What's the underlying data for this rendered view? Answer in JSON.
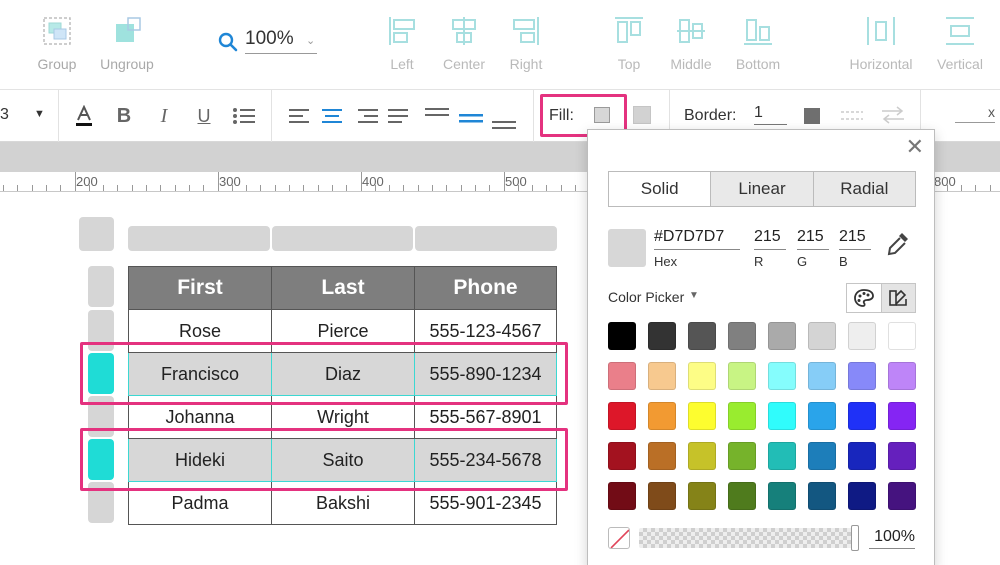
{
  "toolbar": {
    "group_label": "Group",
    "ungroup_label": "Ungroup",
    "zoom_value": "100%",
    "align": {
      "left": "Left",
      "center": "Center",
      "right": "Right",
      "top": "Top",
      "middle": "Middle",
      "bottom": "Bottom"
    },
    "distribute": {
      "horizontal": "Horizontal",
      "vertical": "Vertical"
    }
  },
  "format_bar": {
    "font_size_partial": "3",
    "fill_label": "Fill:",
    "fill_color": "#D7D7D7",
    "border_label": "Border:",
    "border_width": "1",
    "x_value": "x"
  },
  "ruler": {
    "labels": [
      "200",
      "300",
      "400",
      "500",
      "800"
    ]
  },
  "table": {
    "headers": [
      "First",
      "Last",
      "Phone"
    ],
    "rows": [
      {
        "first": "Rose",
        "last": "Pierce",
        "phone": "555-123-4567",
        "selected": false
      },
      {
        "first": "Francisco",
        "last": "Diaz",
        "phone": "555-890-1234",
        "selected": true
      },
      {
        "first": "Johanna",
        "last": "Wright",
        "phone": "555-567-8901",
        "selected": false
      },
      {
        "first": "Hideki",
        "last": "Saito",
        "phone": "555-234-5678",
        "selected": true
      },
      {
        "first": "Padma",
        "last": "Bakshi",
        "phone": "555-901-2345",
        "selected": false
      }
    ],
    "header_bg": "#7E7E7E",
    "selected_bg": "#D7D7D7",
    "selection_accent": "#1FDCD6",
    "highlight_color": "#E4327F"
  },
  "color_picker": {
    "tabs": [
      "Solid",
      "Linear",
      "Radial"
    ],
    "active_tab": "Solid",
    "hex_value": "#D7D7D7",
    "hex_label": "Hex",
    "r_value": "215",
    "g_value": "215",
    "b_value": "215",
    "r_label": "R",
    "g_label": "G",
    "b_label": "B",
    "picker_label": "Color Picker",
    "opacity": "100%",
    "swatches": [
      [
        "#000000",
        "#333333",
        "#555555",
        "#808080",
        "#aaaaaa",
        "#d4d4d4",
        "#eeeeee",
        "#ffffff"
      ],
      [
        "#ea7f8a",
        "#f7c98f",
        "#fdfd86",
        "#c8f484",
        "#85fdfd",
        "#86cdf7",
        "#8789f9",
        "#be85f8"
      ],
      [
        "#dd1729",
        "#f29a32",
        "#fdfd2f",
        "#99ec2f",
        "#30fcfc",
        "#2aa4ea",
        "#1f31f7",
        "#8525f3"
      ],
      [
        "#a3121f",
        "#ba6f26",
        "#c6c229",
        "#76b32b",
        "#22bdb6",
        "#1d7eba",
        "#1826bd",
        "#6520bd"
      ],
      [
        "#720c16",
        "#7f4b1a",
        "#858318",
        "#4f7b1d",
        "#16807b",
        "#135781",
        "#0f1a84",
        "#45137f"
      ]
    ]
  }
}
